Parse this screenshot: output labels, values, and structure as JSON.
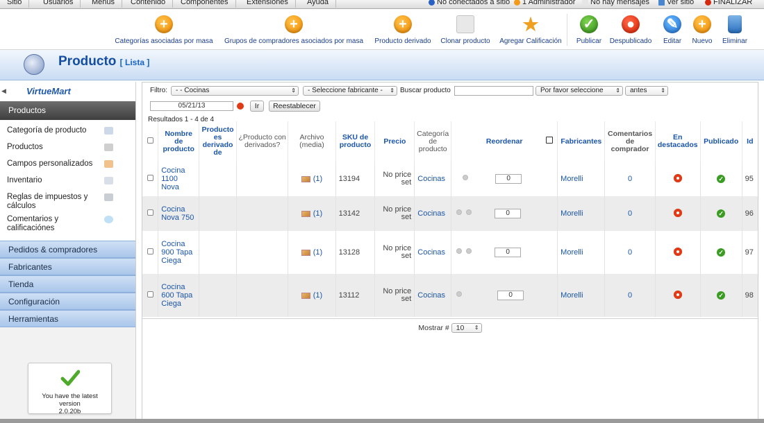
{
  "top_menu": {
    "items": [
      "Sitio",
      "Usuarios",
      "Menús",
      "Contenido",
      "Componentes",
      "Extensiones",
      "Ayuda"
    ],
    "status": {
      "connected": "No conectados a sitio",
      "admin": "1 Administrador",
      "messages": "No hay mensajes",
      "view_site": "Ver sitio",
      "logout": "FINALIZAR"
    }
  },
  "toolbar": {
    "buttons": [
      {
        "label": "Categorías asociadas por masa",
        "icon": "add-icon"
      },
      {
        "label": "Grupos de compradores asociados por masa",
        "icon": "add-icon"
      },
      {
        "label": "Producto derivado",
        "icon": "add-icon"
      },
      {
        "label": "Clonar producto",
        "icon": "copy-icon"
      },
      {
        "label": "Agregar Calificación",
        "icon": "star-icon"
      },
      {
        "label": "Publicar",
        "icon": "check-icon"
      },
      {
        "label": "Despublicado",
        "icon": "unpublish-icon"
      },
      {
        "label": "Editar",
        "icon": "edit-icon"
      },
      {
        "label": "Nuevo",
        "icon": "add-icon"
      },
      {
        "label": "Eliminar",
        "icon": "trash-icon"
      }
    ]
  },
  "title": {
    "main": "Producto",
    "sub": "[ Lista ]"
  },
  "sidebar": {
    "brand": "VirtueMart",
    "active_section": "Productos",
    "sub_items": [
      {
        "label": "Categoría de producto"
      },
      {
        "label": "Productos"
      },
      {
        "label": "Campos personalizados"
      },
      {
        "label": "Inventario"
      },
      {
        "label": "Reglas de impuestos y cálculos"
      },
      {
        "label": "Comentarios y calificaciónes"
      }
    ],
    "sections": [
      "Pedidos & compradores",
      "Fabricantes",
      "Tienda",
      "Configuración",
      "Herramientas"
    ],
    "update_box": {
      "line1": "You have the latest",
      "line2": "version",
      "line3": "2.0.20b"
    }
  },
  "filters": {
    "filter_label": "Filtro:",
    "category_select": "- - Cocinas",
    "manufacturer_select": "- Seleccione fabricante -",
    "search_label": "Buscar producto",
    "search_value": "",
    "please_select": "Por favor seleccione",
    "when_select": "antes",
    "date_value": "05/21/13",
    "go_button": "Ir",
    "reset_button": "Reestablecer",
    "results": "Resultados 1 - 4 de 4"
  },
  "table": {
    "headers": {
      "name": "Nombre de producto",
      "is_child": "Producto es derivado de",
      "has_children": "¿Producto con derivados?",
      "media": "Archivo (media)",
      "sku": "SKU de producto",
      "price": "Precio",
      "category": "Categoría de producto",
      "reorder": "Reordenar",
      "manufacturers": "Fabricantes",
      "reviews": "Comentarios de comprador",
      "featured": "En destacados",
      "published": "Publicado",
      "id": "Id"
    },
    "rows": [
      {
        "name": "Cocina 1100 Nova",
        "media": "(1)",
        "sku": "13194",
        "price": "No price set",
        "category": "Cocinas",
        "order": "0",
        "manufacturer": "Morelli",
        "reviews": "0",
        "id": "95"
      },
      {
        "name": "Cocina Nova 750",
        "media": "(1)",
        "sku": "13142",
        "price": "No price set",
        "category": "Cocinas",
        "order": "0",
        "manufacturer": "Morelli",
        "reviews": "0",
        "id": "96"
      },
      {
        "name": "Cocina 900 Tapa Ciega",
        "media": "(1)",
        "sku": "13128",
        "price": "No price set",
        "category": "Cocinas",
        "order": "0",
        "manufacturer": "Morelli",
        "reviews": "0",
        "id": "97"
      },
      {
        "name": "Cocina 600 Tapa Ciega",
        "media": "(1)",
        "sku": "13112",
        "price": "No price set",
        "category": "Cocinas",
        "order": "0",
        "manufacturer": "Morelli",
        "reviews": "0",
        "id": "98"
      }
    ]
  },
  "pager": {
    "label": "Mostrar #",
    "value": "10"
  }
}
